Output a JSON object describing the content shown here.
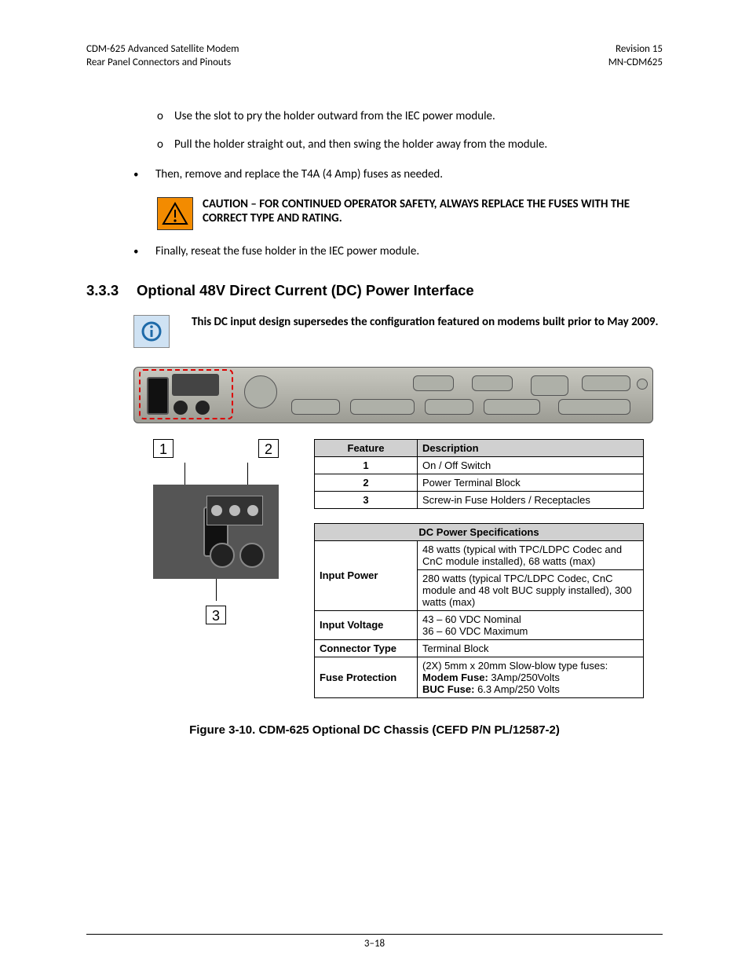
{
  "header": {
    "left_line1": "CDM-625 Advanced Satellite Modem",
    "left_line2": "Rear Panel Connectors and Pinouts",
    "right_line1": "Revision 15",
    "right_line2": "MN-CDM625"
  },
  "sublist": [
    "Use the slot to pry the holder outward from the IEC power module.",
    "Pull the holder straight out, and then swing the holder away from the module."
  ],
  "bullets": {
    "item1": "Then, remove and replace the T4A (4 Amp) fuses as needed.",
    "item2": "Finally, reseat the fuse holder in the IEC power module."
  },
  "caution_text": "CAUTION – FOR CONTINUED OPERATOR SAFETY, ALWAYS REPLACE THE FUSES WITH THE CORRECT TYPE AND RATING.",
  "section": {
    "number": "3.3.3",
    "title": "Optional 48V Direct Current (DC) Power Interface"
  },
  "note_text": "This DC input design supersedes the configuration featured on modems built prior to May 2009.",
  "feature_table": {
    "head_feature": "Feature",
    "head_desc": "Description",
    "rows": [
      {
        "feature": "1",
        "desc": "On / Off Switch"
      },
      {
        "feature": "2",
        "desc": "Power Terminal Block"
      },
      {
        "feature": "3",
        "desc": "Screw-in Fuse Holders / Receptacles"
      }
    ]
  },
  "spec_table": {
    "title": "DC Power Specifications",
    "rows": {
      "input_power_label": "Input Power",
      "input_power_a": "48 watts (typical with TPC/LDPC Codec and CnC module installed), 68 watts (max)",
      "input_power_b": "280 watts (typical TPC/LDPC Codec, CnC module and 48 volt BUC supply installed), 300 watts (max)",
      "input_voltage_label": "Input Voltage",
      "input_voltage_a": "43 – 60 VDC Nominal",
      "input_voltage_b": "36 – 60 VDC Maximum",
      "connector_label": "Connector Type",
      "connector_val": "Terminal Block",
      "fuse_label": "Fuse Protection",
      "fuse_line1": "(2X) 5mm x 20mm Slow-blow type fuses:",
      "fuse_modem_b": "Modem Fuse:",
      "fuse_modem_v": " 3Amp/250Volts",
      "fuse_buc_b": "BUC Fuse:",
      "fuse_buc_v": " 6.3 Amp/250 Volts"
    }
  },
  "callouts": {
    "c1": "1",
    "c2": "2",
    "c3": "3"
  },
  "figure_caption": "Figure 3-10. CDM-625 Optional DC Chassis (CEFD P/N PL/12587-2)",
  "footer": "3–18"
}
